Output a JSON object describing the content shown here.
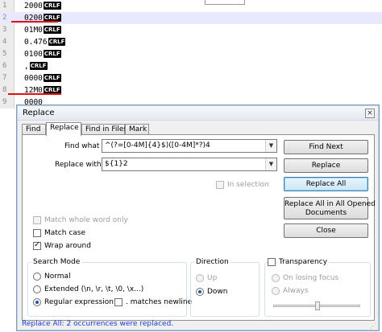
{
  "editor": {
    "lines": [
      {
        "num": "1",
        "text": "2000",
        "eol": "CRLF"
      },
      {
        "num": "2",
        "text": "0200",
        "eol": "CRLF"
      },
      {
        "num": "3",
        "text": "01M0",
        "eol": "CRLF"
      },
      {
        "num": "4",
        "text": "0.476",
        "eol": "CRLF"
      },
      {
        "num": "5",
        "text": "0100",
        "eol": "CRLF"
      },
      {
        "num": "6",
        "text": ",",
        "eol": "CRLF"
      },
      {
        "num": "7",
        "text": "0000",
        "eol": "CRLF"
      },
      {
        "num": "8",
        "text": "12M0",
        "eol": "CRLF"
      },
      {
        "num": "9",
        "text": "0000",
        "eol": ""
      }
    ]
  },
  "dialog": {
    "title": "Replace",
    "close_glyph": "×",
    "tabs": [
      "Find",
      "Replace",
      "Find in Files",
      "Mark"
    ],
    "find_label": "Find what :",
    "find_value": "^(?=[0-4M]{4}$)([0-4M]*?)4",
    "replace_label": "Replace with :",
    "replace_value": "${1}2",
    "in_selection_label": "In selection",
    "buttons": {
      "find_next": "Find Next",
      "replace": "Replace",
      "replace_all": "Replace All",
      "replace_all_opened_line1": "Replace All in All Opened",
      "replace_all_opened_line2": "Documents",
      "close": "Close"
    },
    "options": {
      "match_whole_word": "Match whole word only",
      "match_case": "Match case",
      "wrap_around": "Wrap around"
    },
    "search_mode": {
      "title": "Search Mode",
      "normal": "Normal",
      "extended": "Extended (\\n, \\r, \\t, \\0, \\x...)",
      "regex": "Regular expression",
      "matches_newline": ". matches newline"
    },
    "direction": {
      "title": "Direction",
      "up": "Up",
      "down": "Down"
    },
    "transparency": {
      "title": "Transparency",
      "on_losing_focus": "On losing focus",
      "always": "Always"
    },
    "status": "Replace All: 2 occurrences were replaced.",
    "grip_glyph": "⋰"
  },
  "colors": {
    "underline": "#e01010",
    "status_text": "#1a3bd1",
    "current_line": "#e8e8ff"
  }
}
